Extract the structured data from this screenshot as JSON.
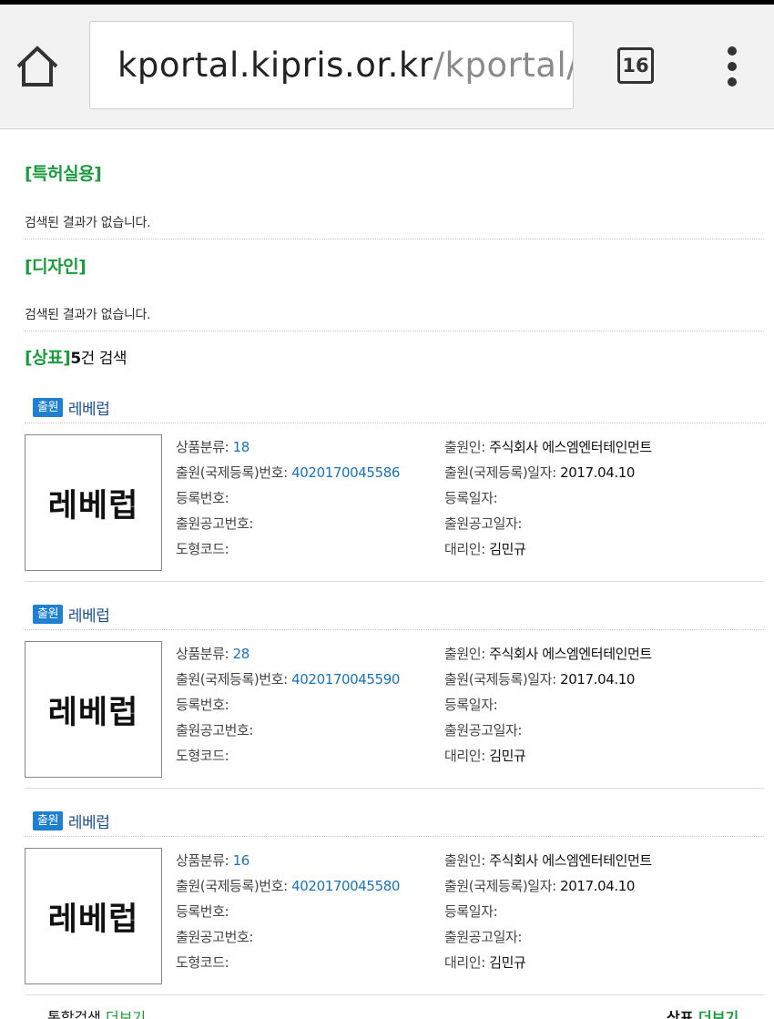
{
  "browser": {
    "url_host": "kportal.kipris.or.kr",
    "url_path": "/kportal/se",
    "tab_count": "16"
  },
  "sections": {
    "patent": {
      "title": "[특허실용]",
      "empty_message": "검색된 결과가 없습니다."
    },
    "design": {
      "title": "[디자인]",
      "empty_message": "검색된 결과가 없습니다."
    },
    "trademark": {
      "title": "[상표]",
      "count": "5",
      "count_suffix": "건 검색"
    }
  },
  "labels": {
    "class": "상품분류: ",
    "app_number": "출원(국제등록)번호: ",
    "reg_number": "등록번호:",
    "pub_number": "출원공고번호:",
    "figure_code": "도형코드:",
    "applicant": "출원인: ",
    "app_date": "출원(국제등록)일자: ",
    "reg_date": "등록일자:",
    "pub_date": "출원공고일자:",
    "agent": "대리인: "
  },
  "items": [
    {
      "status": "출원",
      "name": "레베럽",
      "mark_text": "레베럽",
      "class": "18",
      "app_number": "4020170045586",
      "applicant": "주식회사 에스엠엔터테인먼트",
      "app_date": "2017.04.10",
      "agent": "김민규"
    },
    {
      "status": "출원",
      "name": "레베럽",
      "mark_text": "레베럽",
      "class": "28",
      "app_number": "4020170045590",
      "applicant": "주식회사 에스엠엔터테인먼트",
      "app_date": "2017.04.10",
      "agent": "김민규"
    },
    {
      "status": "출원",
      "name": "레베럽",
      "mark_text": "레베럽",
      "class": "16",
      "app_number": "4020170045580",
      "applicant": "주식회사 에스엠엔터테인먼트",
      "app_date": "2017.04.10",
      "agent": "김민규"
    }
  ],
  "bottom": {
    "left_label": "통합검색 ",
    "left_more": "더보기",
    "right_label": "상표 ",
    "right_more": "더보기"
  },
  "colors": {
    "section_green": "#1a9c3c",
    "badge_blue": "#1f7fd1",
    "link_blue": "#1a73b9",
    "name_blue": "#1d4f91"
  },
  "icons": {
    "home": "home-icon",
    "menu": "more-vert-icon"
  }
}
